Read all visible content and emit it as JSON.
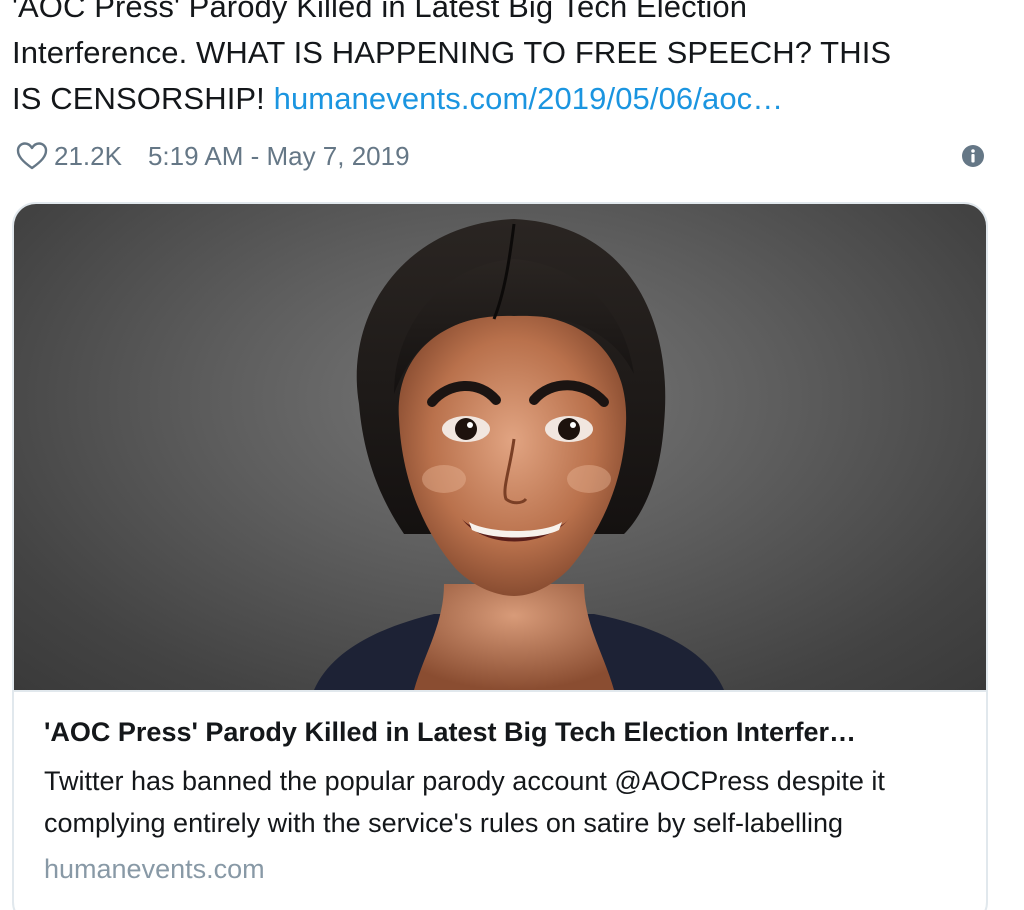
{
  "tweet": {
    "text_line1": "'AOC Press' Parody Killed in Latest Big Tech Election",
    "text_line2": "Interference.  WHAT IS HAPPENING TO FREE SPEECH? THIS",
    "text_line3": "IS CENSORSHIP! ",
    "link_text": "humanevents.com/2019/05/06/aoc…",
    "like_icon": "heart-outline-icon",
    "like_count": "21.2K",
    "timestamp": "5:19 AM - May 7, 2019",
    "info_icon": "info-circle-icon"
  },
  "card": {
    "image_description_icon": "caricature-portrait-image",
    "title": "'AOC Press' Parody Killed in Latest Big Tech Election Interfer…",
    "description": "Twitter has banned the popular parody account @AOCPress despite it complying entirely with the service's rules on satire by self-labelling",
    "domain": "humanevents.com"
  },
  "colors": {
    "text": "#14171a",
    "link": "#1b95e0",
    "meta": "#657786",
    "domain": "#8899a6",
    "border": "#e1e8ed"
  }
}
